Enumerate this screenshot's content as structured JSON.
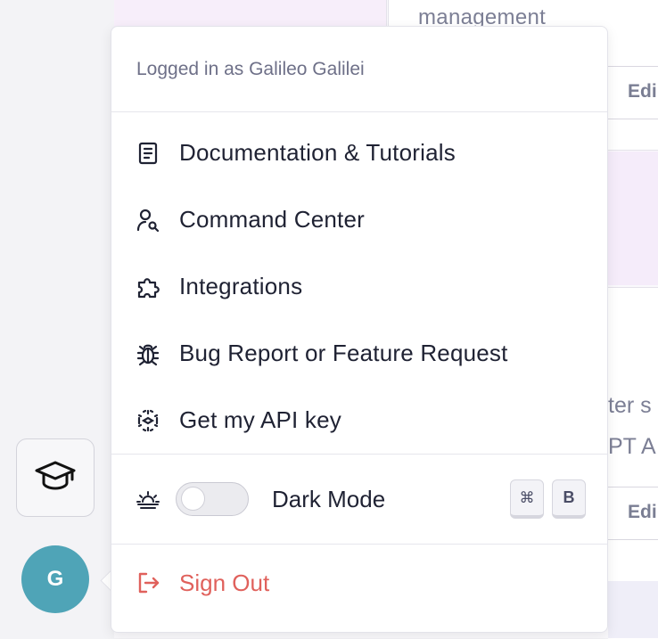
{
  "background": {
    "card_partial_text": "management",
    "edit_label_top": "Edi",
    "edit_label_bottom": "Edi",
    "card2_line1": "ter s",
    "card2_line2": "PT AI"
  },
  "sidebar": {
    "academy_icon": "graduation-cap-icon",
    "avatar_initial": "G",
    "avatar_color": "#4fa4b7"
  },
  "menu": {
    "header": "Logged in as Galileo Galilei",
    "items": [
      {
        "label": "Documentation & Tutorials",
        "icon": "document-icon"
      },
      {
        "label": "Command Center",
        "icon": "user-search-icon"
      },
      {
        "label": "Integrations",
        "icon": "puzzle-icon"
      },
      {
        "label": "Bug Report or Feature Request",
        "icon": "bug-icon"
      },
      {
        "label": "Get my API key",
        "icon": "key-dots-icon"
      }
    ],
    "dark_mode": {
      "label": "Dark Mode",
      "icon": "sunrise-icon",
      "enabled": false,
      "shortcut": [
        "⌘",
        "B"
      ]
    },
    "sign_out": {
      "label": "Sign Out",
      "icon": "logout-icon",
      "color": "#e0615c"
    }
  }
}
